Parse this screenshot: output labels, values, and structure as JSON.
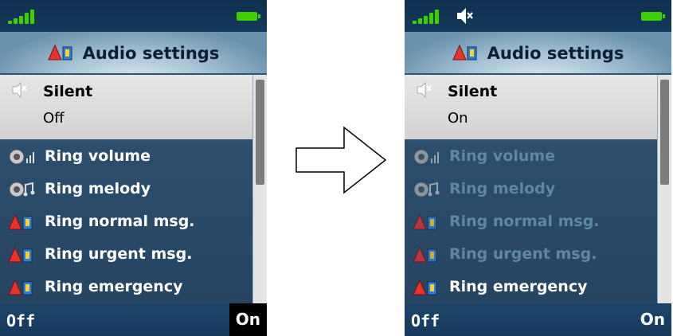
{
  "left": {
    "title": "Audio settings",
    "selected": {
      "label": "Silent",
      "value": "Off"
    },
    "items": [
      {
        "label": "Ring volume",
        "icon": "speaker-icon"
      },
      {
        "label": "Ring melody",
        "icon": "melody-icon"
      },
      {
        "label": "Ring normal msg.",
        "icon": "audio-settings-icon"
      },
      {
        "label": "Ring urgent msg.",
        "icon": "audio-settings-icon"
      },
      {
        "label": "Ring emergency",
        "icon": "audio-settings-icon"
      }
    ],
    "softkeys": {
      "left": "Off",
      "right": "On"
    }
  },
  "right": {
    "title": "Audio settings",
    "selected": {
      "label": "Silent",
      "value": "On"
    },
    "items": [
      {
        "label": "Ring volume",
        "icon": "speaker-icon",
        "dimmed": true
      },
      {
        "label": "Ring melody",
        "icon": "melody-icon",
        "dimmed": true
      },
      {
        "label": "Ring normal msg.",
        "icon": "audio-settings-icon",
        "dimmed": true
      },
      {
        "label": "Ring urgent msg.",
        "icon": "audio-settings-icon",
        "dimmed": true
      },
      {
        "label": "Ring emergency",
        "icon": "audio-settings-icon",
        "dimmed": false
      }
    ],
    "softkeys": {
      "left": "Off",
      "right": "On"
    }
  },
  "colors": {
    "accent_green": "#3cd000",
    "list_bg": "#2c4d6c",
    "dim_text": "#5f86a3",
    "selected_bg": "#d3d3d3"
  },
  "transition_icon": "right-arrow-icon"
}
